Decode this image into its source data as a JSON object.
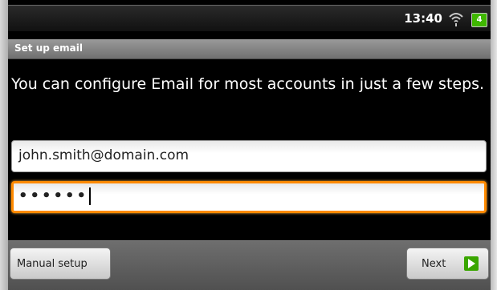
{
  "status_bar": {
    "time": "13:40",
    "battery_level": "4",
    "icons": [
      "wifi-icon",
      "battery-icon"
    ]
  },
  "title_bar": {
    "title": "Set up email"
  },
  "intro": {
    "text": "You can configure Email for most accounts in just a few steps."
  },
  "form": {
    "email_value": "john.smith@domain.com",
    "password_value": "••••••"
  },
  "buttons": {
    "manual_setup": "Manual setup",
    "next": "Next"
  },
  "colors": {
    "focus_border": "#ff8a00",
    "next_icon": "#3aa600",
    "battery": "#3fb700"
  }
}
